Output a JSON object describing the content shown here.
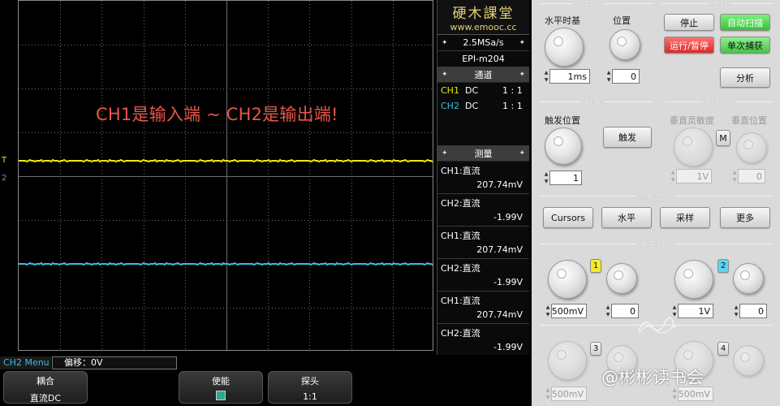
{
  "screen": {
    "annotation": "CH1是输入端 ~ CH2是输出端!",
    "trig_marker": "T",
    "ch1_marker": "1",
    "ch2_marker": "2",
    "colors": {
      "ch1": "#f2e610",
      "ch2": "#3cbde2",
      "annotation": "#e9564a",
      "grid": "#6e6e6e"
    },
    "traces": {
      "ch1_level_fraction": 0.455,
      "ch2_level_fraction": 0.75
    }
  },
  "meas": {
    "logo_cn": "硬木課堂",
    "logo_url": "www.emooc.cc",
    "rate": "2.5MSa/s",
    "model": "EPI-m204",
    "channels_title": "通道",
    "channels": [
      {
        "name": "CH1",
        "coupling": "DC",
        "ratio": "1 : 1"
      },
      {
        "name": "CH2",
        "coupling": "DC",
        "ratio": "1 : 1"
      }
    ],
    "measure_title": "测量",
    "items": [
      {
        "label": "CH1:直流",
        "value": "207.74mV"
      },
      {
        "label": "CH2:直流",
        "value": "-1.99V"
      },
      {
        "label": "CH1:直流",
        "value": "207.74mV"
      },
      {
        "label": "CH2:直流",
        "value": "-1.99V"
      },
      {
        "label": "CH1:直流",
        "value": "207.74mV"
      },
      {
        "label": "CH2:直流",
        "value": "-1.99V"
      }
    ]
  },
  "ctrl": {
    "horizontal_title": "水平轴",
    "run_title": "运行",
    "timebase_label": "水平时基",
    "position_label": "位置",
    "timebase_value": "1ms",
    "position_value": "0",
    "stop": "停止",
    "auto": "自动扫描",
    "run_pause": "运行/暂停",
    "single": "单次捕获",
    "analyze": "分析",
    "trigger_title": "触发",
    "math_title": "Math",
    "trig_pos_label": "触发位置",
    "trig_pos_value": "1",
    "trigger_btn": "触发",
    "vert_sens_label": "垂直灵敏度",
    "vert_pos_label": "垂直位置",
    "math_m": "M",
    "math_sens_value": "1V",
    "math_pos_value": "0",
    "console_title": "控制台",
    "cursors": "Cursors",
    "horizontal": "水平",
    "sample": "采样",
    "more": "更多",
    "vertical_title": "垂直轴",
    "ch1_num": "1",
    "ch2_num": "2",
    "ch3_num": "3",
    "ch4_num": "4",
    "ch1_volts": "500mV",
    "ch1_pos": "0",
    "ch2_volts": "1V",
    "ch2_pos": "0",
    "ch3_volts": "500mV",
    "ch4_volts": "500mV"
  },
  "bottom": {
    "menu_label": "CH2 Menu",
    "offset": "偏移：0V",
    "coupling_title": "耦合",
    "coupling_value": "直流DC",
    "enable_title": "使能",
    "probe_title": "探头",
    "probe_value": "1:1"
  },
  "watermark": "@彬彬读书会"
}
